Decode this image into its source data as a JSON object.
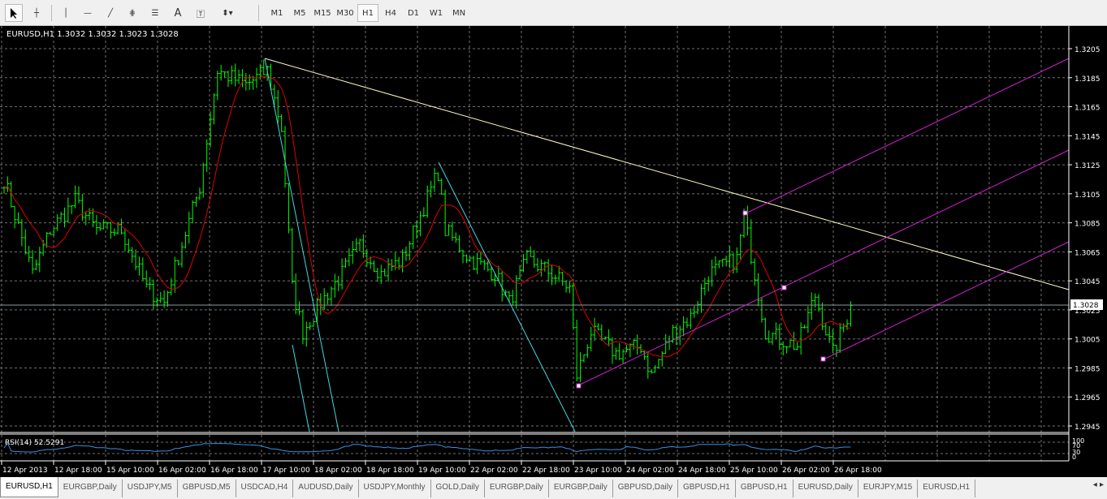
{
  "toolbar": {
    "tools": [
      "cursor",
      "crosshair",
      "vertical-line",
      "horizontal-line",
      "trendline",
      "equidistant-channel",
      "fibonacci",
      "text",
      "text-label",
      "arrows"
    ],
    "text_tool_label": "A",
    "timeframes": [
      "M1",
      "M5",
      "M15",
      "M30",
      "H1",
      "H4",
      "D1",
      "W1",
      "MN"
    ],
    "selected_timeframe": "H1"
  },
  "chart": {
    "header": "EURUSD,H1  1.3032 1.3032 1.3023 1.3028",
    "current_price": "1.3028",
    "price_labels": [
      "1.3205",
      "1.3185",
      "1.3165",
      "1.3145",
      "1.3125",
      "1.3105",
      "1.3085",
      "1.3065",
      "1.3045",
      "1.3025",
      "1.3005",
      "1.2985",
      "1.2965",
      "1.2945"
    ],
    "time_labels": [
      "12 Apr 2013",
      "12 Apr 18:00",
      "15 Apr 10:00",
      "16 Apr 02:00",
      "16 Apr 18:00",
      "17 Apr 10:00",
      "18 Apr 02:00",
      "18 Apr 18:00",
      "19 Apr 10:00",
      "22 Apr 02:00",
      "22 Apr 18:00",
      "23 Apr 10:00",
      "24 Apr 02:00",
      "24 Apr 18:00",
      "25 Apr 10:00",
      "26 Apr 02:00",
      "26 Apr 18:00"
    ],
    "rsi_label": "RSI(14) 52.5291",
    "rsi_levels": [
      "100",
      "70",
      "30",
      "0"
    ],
    "colors": {
      "bars": "#00ff00",
      "ma": "#ff0000",
      "trend": "#ffffc0",
      "cyan": "#40e0e0",
      "channel": "#d020d0",
      "rsi": "#1e90ff"
    }
  },
  "chart_data": {
    "type": "line",
    "symbol": "EURUSD",
    "timeframe": "H1",
    "ylim": [
      1.2935,
      1.3215
    ],
    "price_path_bar_index": [
      0,
      8,
      13,
      20,
      26,
      33,
      40,
      45,
      50,
      55,
      60,
      68,
      74,
      78,
      81,
      84,
      89,
      95,
      100,
      106,
      112,
      117,
      122,
      124,
      131,
      138,
      142,
      147,
      154,
      159,
      161,
      165,
      172,
      179,
      182,
      188,
      193,
      198,
      206,
      208,
      214,
      218,
      223,
      228,
      233,
      237,
      238
    ],
    "price_path_close": [
      1.3115,
      1.305,
      1.308,
      1.31,
      1.308,
      1.308,
      1.304,
      1.303,
      1.307,
      1.311,
      1.319,
      1.318,
      1.319,
      1.315,
      1.304,
      1.301,
      1.303,
      1.305,
      1.307,
      1.305,
      1.306,
      1.309,
      1.312,
      1.308,
      1.306,
      1.305,
      1.303,
      1.306,
      1.305,
      1.304,
      1.298,
      1.301,
      1.2995,
      1.3,
      1.298,
      1.301,
      1.302,
      1.305,
      1.306,
      1.309,
      1.301,
      1.3005,
      1.3,
      1.3035,
      1.2995,
      1.302,
      1.3028
    ]
  },
  "tabs": [
    "EURUSD,H1",
    "EURGBP,Daily",
    "USDJPY,M5",
    "GBPUSD,M5",
    "USDCAD,H4",
    "AUDUSD,Daily",
    "USDJPY,Monthly",
    "GOLD,Daily",
    "EURGBP,Daily",
    "EURGBP,Daily",
    "GBPUSD,Daily",
    "GBPUSD,H1",
    "GBPUSD,H1",
    "EURUSD,Daily",
    "EURJPY,M15",
    "EURUSD,H1"
  ]
}
